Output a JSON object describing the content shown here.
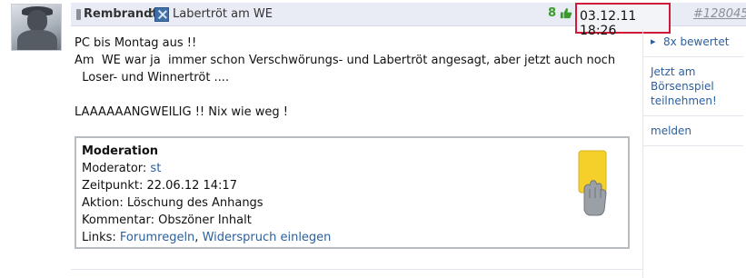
{
  "post": {
    "author": "Rembrandt",
    "colon": ":",
    "title": "Labertröt am WE",
    "rating": "8",
    "date": "03.12.11 18:26",
    "post_number": "#128045",
    "lines": [
      "PC bis Montag aus !!",
      "Am  WE war ja  immer schon Verschwörungs- und Labertröt angesagt, aber jetzt auch noch",
      "  Loser- und Winnertröt ....",
      "",
      "LAAAAAANGWEILIG !! Nix wie weg !"
    ]
  },
  "moderation": {
    "title": "Moderation",
    "moderator_label": "Moderator: ",
    "moderator": "st",
    "time_label": "Zeitpunkt: 22.06.12 14:17",
    "action_label": "Aktion: Löschung des Anhangs",
    "comment_label": "Kommentar: Obszöner Inhalt",
    "links_label": "Links: ",
    "link_rules": "Forumregeln",
    "link_separator": ", ",
    "link_objection": "Widerspruch einlegen"
  },
  "sidebar": {
    "rated": "8x bewertet",
    "game_line1": "Jetzt am",
    "game_line2": "Börsenspiel",
    "game_line3": "teilnehmen!",
    "report": "melden"
  },
  "colors": {
    "header_bg": "#e9ecf4",
    "date_highlight": "#d11a3a",
    "link": "#2c5f9e",
    "rating_green": "#3a9a2a",
    "yellow_card": "#f5cf2a"
  }
}
